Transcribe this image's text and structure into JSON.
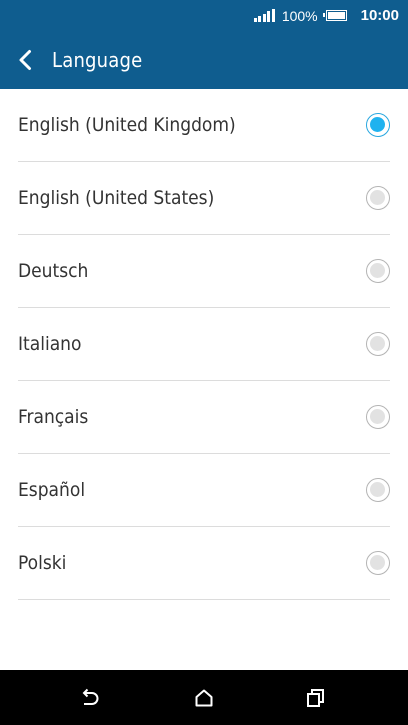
{
  "status_bar": {
    "battery_percent": "100%",
    "time": "10:00",
    "icons": [
      "signal-icon",
      "battery-icon"
    ]
  },
  "app_bar": {
    "title": "Language",
    "back_icon": "chevron-left-icon"
  },
  "languages": [
    {
      "label": "English (United Kingdom)",
      "selected": true
    },
    {
      "label": "English (United States)",
      "selected": false
    },
    {
      "label": "Deutsch",
      "selected": false
    },
    {
      "label": "Italiano",
      "selected": false
    },
    {
      "label": "Français",
      "selected": false
    },
    {
      "label": "Español",
      "selected": false
    },
    {
      "label": "Polski",
      "selected": false
    }
  ],
  "nav_bar": {
    "icons": [
      "back-icon",
      "home-icon",
      "recents-icon"
    ]
  },
  "colors": {
    "app_bar": "#0f5d8f",
    "accent": "#1fb2ef",
    "nav_bar": "#000000"
  }
}
